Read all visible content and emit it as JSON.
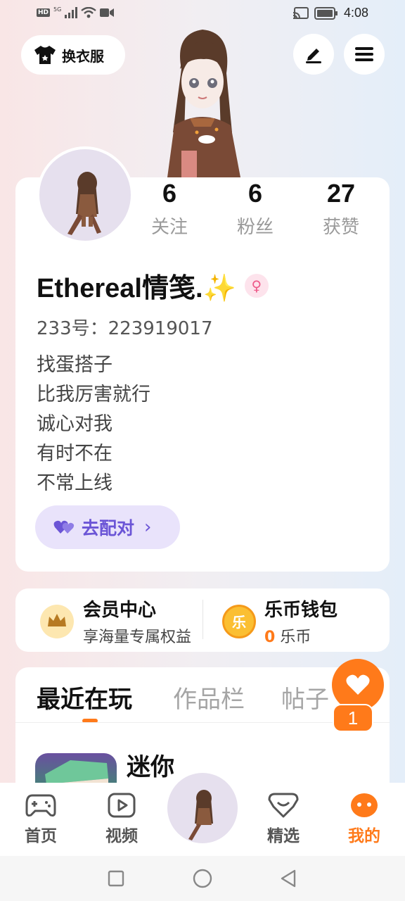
{
  "status_bar": {
    "network_hd": "HD",
    "network_gen": "5G",
    "time": "4:08"
  },
  "header": {
    "outfit_label": "换衣服"
  },
  "profile": {
    "stats": [
      {
        "value": "6",
        "label": "关注"
      },
      {
        "value": "6",
        "label": "粉丝"
      },
      {
        "value": "27",
        "label": "获赞"
      }
    ],
    "username": "Ethereal情笺.✨",
    "gender_icon": "female-icon",
    "user_id": "233号：223919017",
    "bio_lines": [
      "找蛋搭子",
      "比我厉害就行",
      "诚心对我",
      "有时不在",
      "不常上线"
    ],
    "match_label": "去配对",
    "match_chevron": "›"
  },
  "services": {
    "member": {
      "title": "会员中心",
      "subtitle": "享海量专属权益"
    },
    "wallet": {
      "title": "乐币钱包",
      "amount": "0",
      "unit": "乐币",
      "coin_glyph": "乐"
    }
  },
  "tabs": {
    "items": [
      "最近在玩",
      "作品栏",
      "帖子"
    ],
    "active": 0
  },
  "recent_game": {
    "name": "迷你"
  },
  "like_float": {
    "count": "1"
  },
  "bottom_nav": {
    "items": [
      {
        "label": "首页",
        "icon": "gamepad-icon"
      },
      {
        "label": "视频",
        "icon": "play-icon"
      },
      {
        "label": "精选",
        "icon": "heart-badge-icon"
      },
      {
        "label": "我的",
        "icon": "face-icon"
      }
    ],
    "active_index": 3
  },
  "colors": {
    "accent": "#ff7a1a",
    "match_purple": "#6b55d6",
    "match_bg": "#e9e3fb"
  }
}
